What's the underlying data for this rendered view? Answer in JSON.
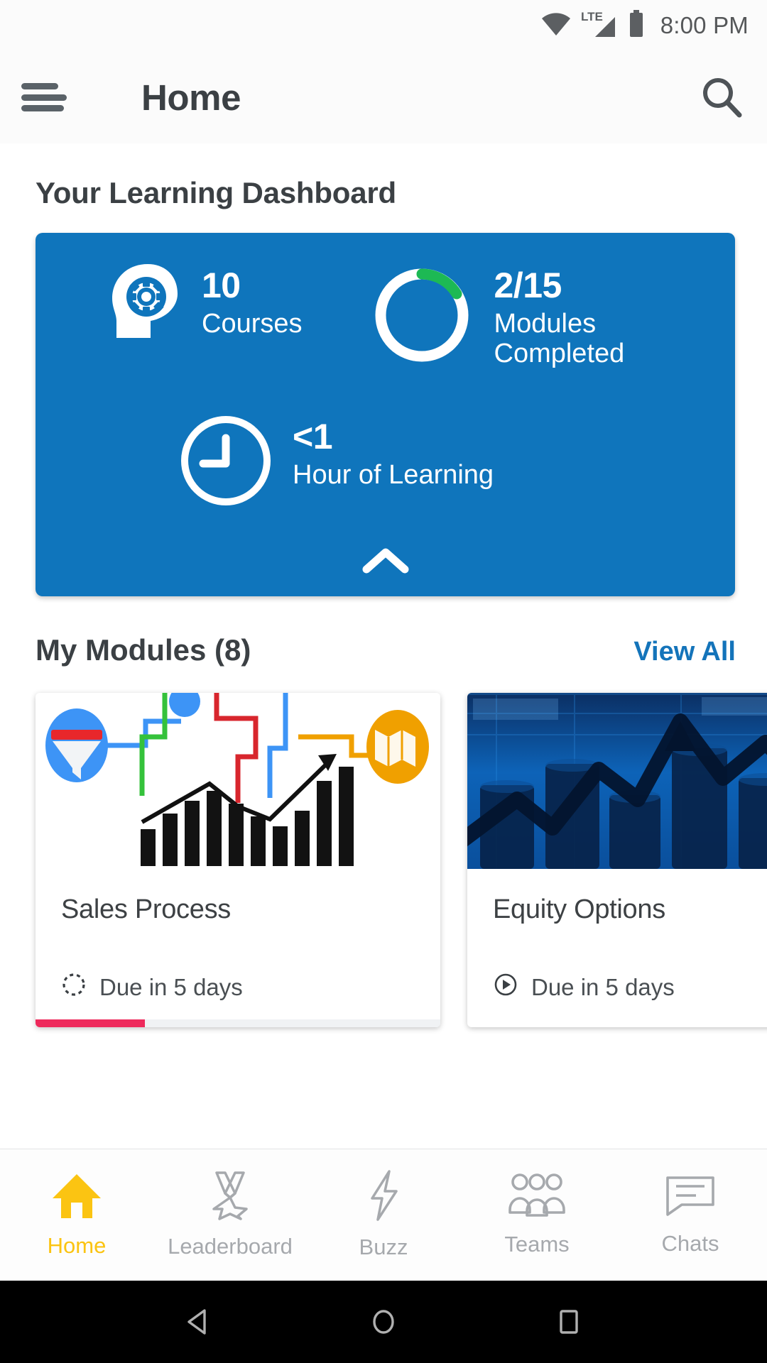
{
  "status_bar": {
    "time": "8:00 PM",
    "network_label": "LTE",
    "icons": [
      "wifi-icon",
      "lte-signal-icon",
      "battery-icon"
    ]
  },
  "app_bar": {
    "menu_icon": "hamburger-menu-icon",
    "title": "Home",
    "search_icon": "search-icon"
  },
  "dashboard": {
    "section_title": "Your Learning Dashboard",
    "accent_color": "#0f75bc",
    "progress_color": "#1db954",
    "stats": [
      {
        "icon": "head-with-gear-icon",
        "value": "10",
        "label": "Courses"
      },
      {
        "icon": "progress-ring-icon",
        "value": "2/15",
        "label": "Modules\nCompleted",
        "completed": 2,
        "total": 15
      },
      {
        "icon": "clock-icon",
        "value": "<1",
        "label": "Hour of Learning"
      }
    ],
    "collapse_icon": "chevron-up-icon"
  },
  "modules": {
    "title": "My Modules (8)",
    "count": 8,
    "view_all_label": "View All",
    "view_all_color": "#1474ba",
    "items": [
      {
        "title": "Sales Process",
        "due_label": "Due in 5 days",
        "status_icon": "dashed-circle-in-progress-icon",
        "thumbnail": "sales-funnel-flowchart-bar-graph-image",
        "progress_percent": 27,
        "progress_color": "#ee2a5c"
      },
      {
        "title": "Equity Options",
        "due_label": "Due in 5 days",
        "status_icon": "play-circle-icon",
        "thumbnail": "blue-stock-chart-coins-image",
        "progress_percent": 0,
        "progress_color": "#ee2a5c"
      }
    ]
  },
  "bottom_nav": {
    "active_color": "#fbc412",
    "inactive_color": "#a6a9ad",
    "items": [
      {
        "label": "Home",
        "icon": "home-icon",
        "active": true
      },
      {
        "label": "Leaderboard",
        "icon": "medal-icon",
        "active": false
      },
      {
        "label": "Buzz",
        "icon": "lightning-bolt-icon",
        "active": false
      },
      {
        "label": "Teams",
        "icon": "people-group-icon",
        "active": false
      },
      {
        "label": "Chats",
        "icon": "chat-bubble-icon",
        "active": false
      }
    ]
  },
  "system_nav": {
    "back_icon": "triangle-back-icon",
    "home_icon": "circle-home-icon",
    "recents_icon": "square-recents-icon"
  }
}
